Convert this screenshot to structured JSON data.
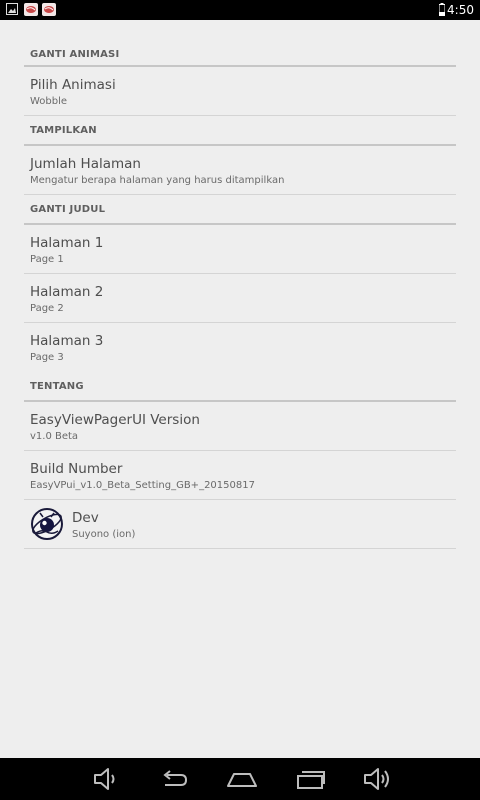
{
  "status_bar": {
    "time": "4:50",
    "icons": [
      "image-notification-icon",
      "app-notification-icon",
      "app-notification-icon",
      "battery-icon"
    ]
  },
  "settings": {
    "cat_animation": "GANTI ANIMASI",
    "pilih_animasi": {
      "title": "Pilih Animasi",
      "summary": "Wobble"
    },
    "cat_display": "TAMPILKAN",
    "jumlah_halaman": {
      "title": "Jumlah Halaman",
      "summary": "Mengatur berapa halaman yang harus ditampilkan"
    },
    "cat_title": "GANTI JUDUL",
    "halaman1": {
      "title": "Halaman 1",
      "summary": "Page 1"
    },
    "halaman2": {
      "title": "Halaman 2",
      "summary": "Page 2"
    },
    "halaman3": {
      "title": "Halaman 3",
      "summary": "Page 3"
    },
    "cat_about": "TENTANG",
    "version": {
      "title": "EasyViewPagerUI Version",
      "summary": "v1.0 Beta"
    },
    "build": {
      "title": "Build Number",
      "summary": "EasyVPui_v1.0_Beta_Setting_GB+_20150817"
    },
    "dev": {
      "title": "Dev",
      "summary": "Suyono (ion)"
    }
  },
  "nav_bar": {
    "buttons": [
      "volume-down-icon",
      "back-icon",
      "home-icon",
      "recents-icon",
      "volume-up-icon"
    ]
  }
}
